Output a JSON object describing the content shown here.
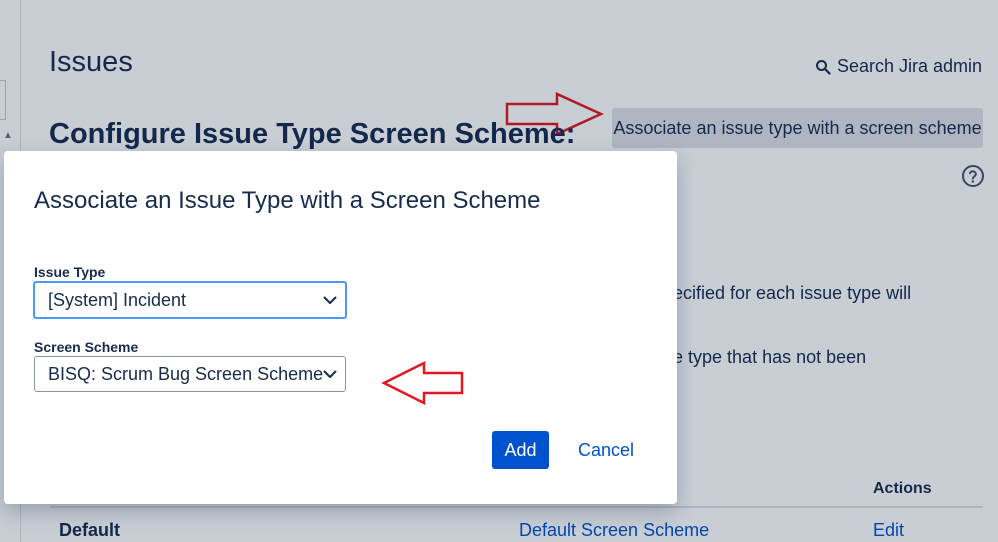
{
  "page": {
    "title": "Issues",
    "search_label": "Search Jira admin",
    "associate_button": "Associate an issue type with a screen scheme",
    "heading": "Configure Issue Type Screen Scheme:",
    "description_1": "pecified for each issue type will",
    "description_2": "ue type that has not been",
    "table": {
      "actions_header": "Actions",
      "rows": [
        {
          "name": "Default",
          "scheme": "Default Screen Scheme",
          "action": "Edit"
        }
      ]
    }
  },
  "modal": {
    "title": "Associate an Issue Type with a Screen Scheme",
    "issue_type_label": "Issue Type",
    "issue_type_value": "[System] Incident",
    "screen_scheme_label": "Screen Scheme",
    "screen_scheme_value": "BISQ: Scrum Bug Screen Scheme",
    "add_label": "Add",
    "cancel_label": "Cancel"
  },
  "icons": {
    "search": "search-icon",
    "help": "help-icon",
    "chevron": "chevron-down-icon",
    "annotation": "red-arrow-annotation"
  },
  "colors": {
    "primary": "#0052cc",
    "focus": "#4c9aff",
    "text": "#172b4d",
    "annotation": "#e3171f"
  }
}
